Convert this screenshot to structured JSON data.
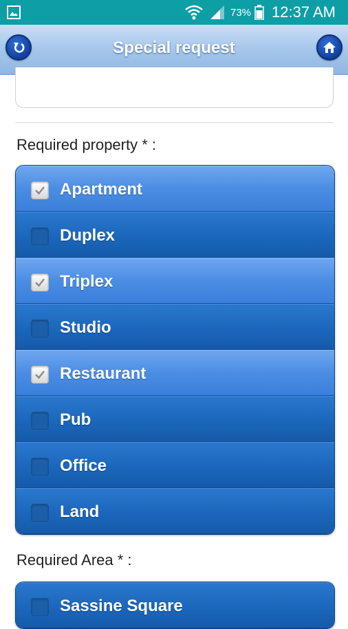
{
  "status_bar": {
    "battery_percent": "73%",
    "time": "12:37 AM",
    "icons": [
      "gallery-icon",
      "wifi-icon",
      "signal-icon",
      "battery-icon"
    ]
  },
  "header": {
    "title": "Special request",
    "back_icon": "back-arrow-icon",
    "home_icon": "home-icon"
  },
  "property_section": {
    "label": "Required property * :",
    "items": [
      {
        "label": "Apartment",
        "checked": true
      },
      {
        "label": "Duplex",
        "checked": false
      },
      {
        "label": "Triplex",
        "checked": true
      },
      {
        "label": "Studio",
        "checked": false
      },
      {
        "label": "Restaurant",
        "checked": true
      },
      {
        "label": "Pub",
        "checked": false
      },
      {
        "label": "Office",
        "checked": false
      },
      {
        "label": "Land",
        "checked": false
      }
    ]
  },
  "area_section": {
    "label": "Required Area * :",
    "items": [
      {
        "label": "Sassine Square",
        "checked": false
      }
    ]
  },
  "colors": {
    "status_bar": "#0d9ea6",
    "item_unchecked": "#1c68bd",
    "item_checked": "#4b8de3",
    "header_gradient_top": "#c9dff5"
  }
}
